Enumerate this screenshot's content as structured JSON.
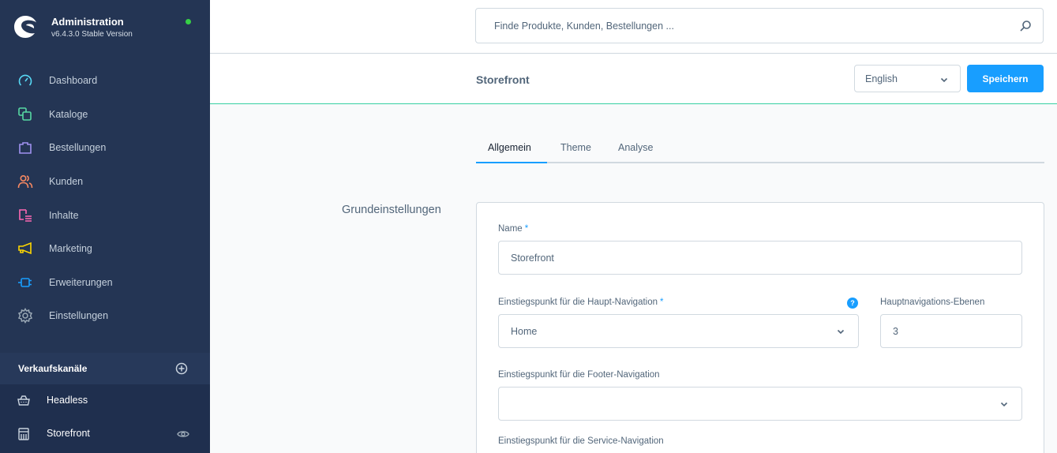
{
  "app": {
    "title": "Administration",
    "version": "v6.4.3.0 Stable Version",
    "status_color": "#37d046"
  },
  "sidebar": {
    "items": [
      {
        "label": "Dashboard",
        "icon": "dashboard-icon",
        "color": "#57d9f5"
      },
      {
        "label": "Kataloge",
        "icon": "catalog-icon",
        "color": "#57d9a3"
      },
      {
        "label": "Bestellungen",
        "icon": "shopping-bag-icon",
        "color": "#a092f0"
      },
      {
        "label": "Kunden",
        "icon": "users-icon",
        "color": "#f88962"
      },
      {
        "label": "Inhalte",
        "icon": "content-icon",
        "color": "#ff68b4"
      },
      {
        "label": "Marketing",
        "icon": "megaphone-icon",
        "color": "#ffd700"
      },
      {
        "label": "Erweiterungen",
        "icon": "plug-icon",
        "color": "#189eff"
      },
      {
        "label": "Einstellungen",
        "icon": "gear-icon",
        "color": "#9aa8b5"
      }
    ],
    "sales_channels": {
      "title": "Verkaufskanäle",
      "items": [
        {
          "label": "Headless",
          "icon": "basket-icon"
        },
        {
          "label": "Storefront",
          "icon": "storefront-icon"
        }
      ]
    }
  },
  "search": {
    "placeholder": "Finde Produkte, Kunden, Bestellungen ..."
  },
  "smartbar": {
    "title": "Storefront",
    "language": "English",
    "save_label": "Speichern"
  },
  "tabs": [
    {
      "label": "Allgemein",
      "active": true
    },
    {
      "label": "Theme",
      "active": false
    },
    {
      "label": "Analyse",
      "active": false
    }
  ],
  "section": {
    "title": "Grundeinstellungen",
    "fields": {
      "name": {
        "label": "Name",
        "required": "*",
        "value": "Storefront"
      },
      "main_nav": {
        "label": "Einstiegspunkt für die Haupt-Navigation",
        "required": "*",
        "value": "Home",
        "help": "?"
      },
      "nav_levels": {
        "label": "Hauptnavigations-Ebenen",
        "value": "3"
      },
      "footer_nav": {
        "label": "Einstiegspunkt für die Footer-Navigation",
        "value": ""
      },
      "service_nav": {
        "label": "Einstiegspunkt für die Service-Navigation"
      }
    }
  },
  "colors": {
    "sidebar_bg": "#243554",
    "accent": "#189eff",
    "smartbar_border": "#37d0a2"
  }
}
